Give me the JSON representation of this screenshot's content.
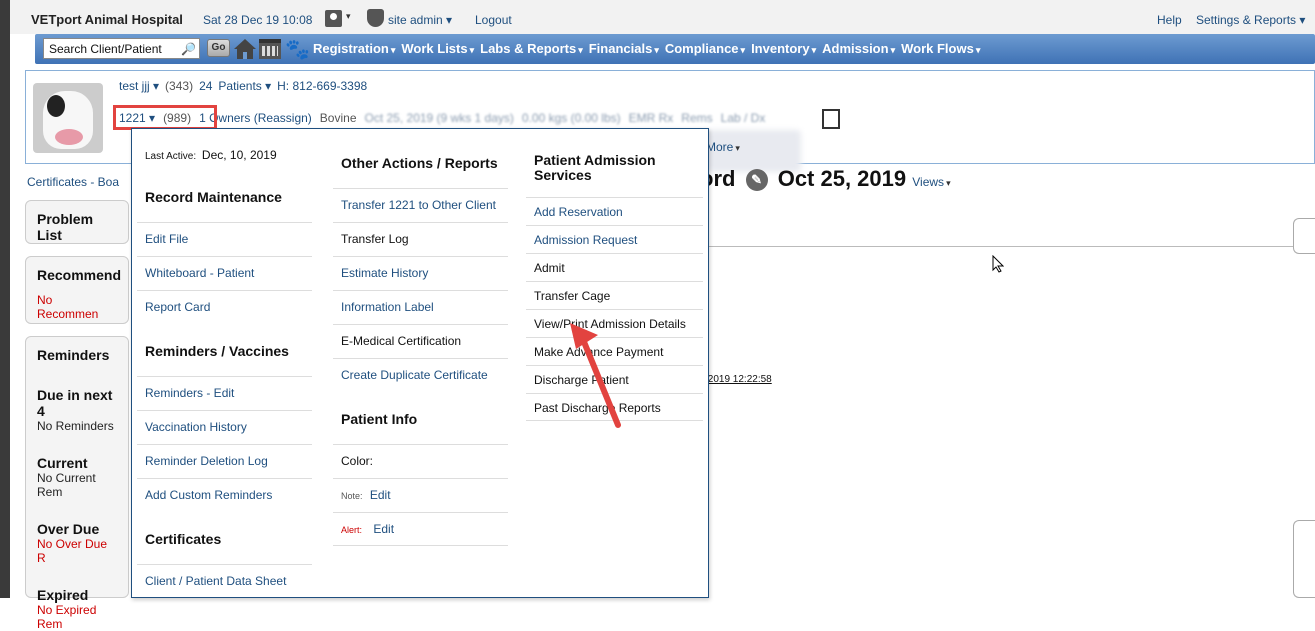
{
  "header": {
    "app_title": "VETport Animal Hospital",
    "datetime": "Sat 28 Dec 19 10:08",
    "user_name": "site admin",
    "logout": "Logout",
    "help": "Help",
    "settings": "Settings & Reports"
  },
  "search": {
    "placeholder": "Search Client/Patient",
    "go": "Go"
  },
  "nav": {
    "items": [
      "Registration",
      "Work Lists",
      "Labs & Reports",
      "Financials",
      "Compliance",
      "Inventory",
      "Admission",
      "Work Flows"
    ]
  },
  "owner": {
    "name": "test jjj",
    "id": "(343)",
    "patients_count": "24",
    "patients_label": "Patients",
    "phone": "H: 812-669-3398"
  },
  "patient": {
    "id": "1221",
    "code": "(989)",
    "owners": "1 Owners (Reassign)",
    "species": "Bovine",
    "dob": "Oct 25, 2019 (9 wks 1 days)",
    "weight": "0.00 kgs (0.00 lbs)",
    "emr": "EMR Rx",
    "rems": "Rems",
    "labdx": "Lab / Dx",
    "more": "More"
  },
  "left_cards": {
    "certificates_link": "Certificates - Boa",
    "problem_list": "Problem List",
    "recommend": "Recommend",
    "no_recommend": "No Recommen",
    "reminders": "Reminders",
    "due_next": "Due in next 4",
    "no_reminders": "No Reminders",
    "current": "Current",
    "no_current": "No Current Rem",
    "over_due": "Over Due",
    "no_over_due": "No Over Due R",
    "expired": "Expired",
    "no_expired": "No Expired Rem"
  },
  "record": {
    "title_prefix": "ord",
    "date": "Oct 25, 2019",
    "views": "Views",
    "timestamp": "c 2019 12:22:58"
  },
  "dropdown": {
    "last_active_label": "Last Active:",
    "last_active_value": "Dec, 10, 2019",
    "record_maintenance": {
      "title": "Record Maintenance",
      "items": [
        "Edit File",
        "Whiteboard - Patient",
        "Report Card"
      ]
    },
    "reminders_vaccines": {
      "title": "Reminders / Vaccines",
      "items": [
        "Reminders - Edit",
        "Vaccination History",
        "Reminder Deletion Log",
        "Add Custom Reminders"
      ]
    },
    "certificates": {
      "title": "Certificates",
      "items": [
        "Client / Patient Data Sheet"
      ]
    },
    "other_actions": {
      "title": "Other Actions / Reports",
      "items": [
        "Transfer 1221 to Other Client",
        "Transfer Log",
        "Estimate History",
        "Information Label",
        "E-Medical Certification",
        "Create Duplicate Certificate"
      ]
    },
    "patient_info": {
      "title": "Patient Info",
      "color_label": "Color:",
      "note_label": "Note:",
      "note_link": "Edit",
      "alert_label": "Alert:",
      "alert_link": "Edit"
    },
    "admission": {
      "title_line1": "Patient Admission",
      "title_line2": "Services",
      "items": [
        "Add Reservation",
        "Admission Request",
        "Admit",
        "Transfer Cage",
        "View/Print Admission Details",
        "Make Advance Payment",
        "Discharge Patient",
        "Past Discharge Reports"
      ]
    }
  }
}
